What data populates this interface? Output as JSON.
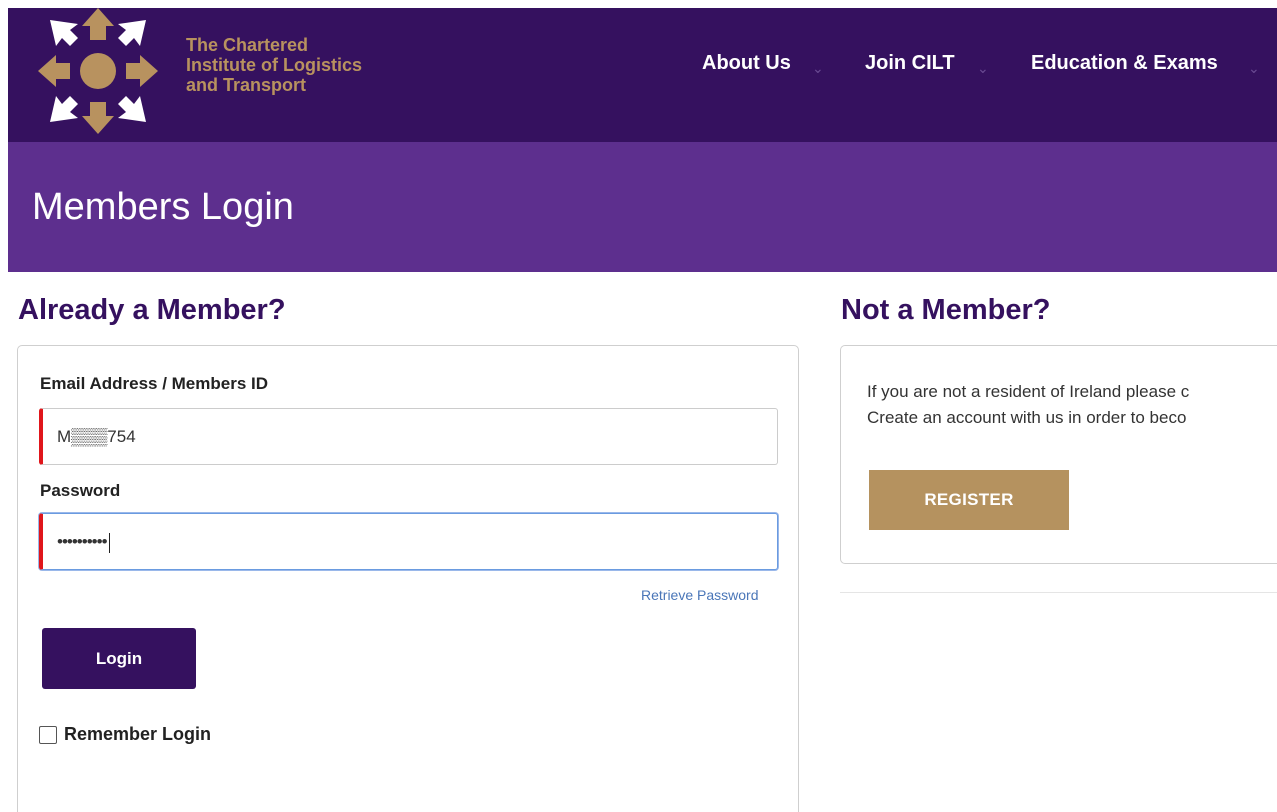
{
  "brand": {
    "name_lines": [
      "The Chartered",
      "Institute of Logistics",
      "and Transport"
    ],
    "logo_icon": "compass-arrows-logo"
  },
  "nav": {
    "items": [
      {
        "label": "About Us",
        "caret": "⌄"
      },
      {
        "label": "Join CILT",
        "caret": "⌄"
      },
      {
        "label": "Education & Exams",
        "caret": "⌄"
      }
    ]
  },
  "page": {
    "title": "Members Login"
  },
  "login": {
    "heading": "Already a Member?",
    "email_label": "Email Address / Members ID",
    "email_value": "M▒▒▒754",
    "password_label": "Password",
    "password_value": "••••••••••",
    "retrieve_label": "Retrieve Password",
    "login_button": "Login",
    "remember_label": "Remember Login"
  },
  "register": {
    "heading": "Not a Member?",
    "line1": "If you are not a resident of Ireland please c",
    "line2": "Create an account with us in order to beco",
    "register_button": "REGISTER"
  },
  "colors": {
    "header_bg": "#35115f",
    "title_band_bg": "#5d2f8e",
    "brand_gold": "#b8925f",
    "error_red": "#e0161b"
  }
}
